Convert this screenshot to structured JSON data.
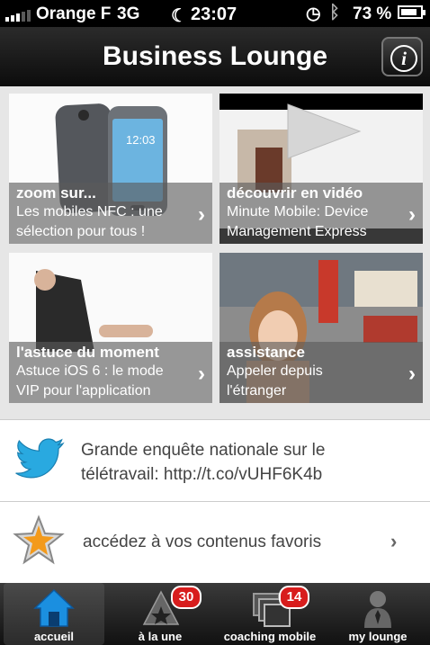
{
  "status_bar": {
    "carrier": "Orange F",
    "network": "3G",
    "time": "23:07",
    "battery": "73 %",
    "battery_level_percent": 73
  },
  "header": {
    "title": "Business Lounge",
    "info_icon": "info-icon"
  },
  "tiles": [
    {
      "title": "zoom sur...",
      "line1": "Les mobiles NFC : une",
      "line2": "sélection pour tous !"
    },
    {
      "title": "découvrir en vidéo",
      "line1": "Minute Mobile: Device",
      "line2": "Management Express"
    },
    {
      "title": "l'astuce du moment",
      "line1": "Astuce iOS 6 : le mode",
      "line2": "VIP pour l'application"
    },
    {
      "title": "assistance",
      "line1": "Appeler depuis",
      "line2": "l'étranger"
    }
  ],
  "tweet": {
    "icon": "twitter-bird-icon",
    "line1": "Grande enquête nationale sur le",
    "line2": "télétravail: http://t.co/vUHF6K4b"
  },
  "favorites": {
    "icon": "star-icon",
    "label": "accédez à vos contenus favoris"
  },
  "tabs": [
    {
      "label": "accueil",
      "icon": "home-icon",
      "selected": true
    },
    {
      "label": "à la une",
      "icon": "news-star-icon",
      "badge": "30"
    },
    {
      "label": "coaching mobile",
      "icon": "screens-icon",
      "badge": "14"
    },
    {
      "label": "my lounge",
      "icon": "person-icon"
    }
  ],
  "colors": {
    "badge": "#d81d1d",
    "twitter": "#29a9e0",
    "home_accent": "#1b8fe0",
    "star": "#f39a1b"
  }
}
